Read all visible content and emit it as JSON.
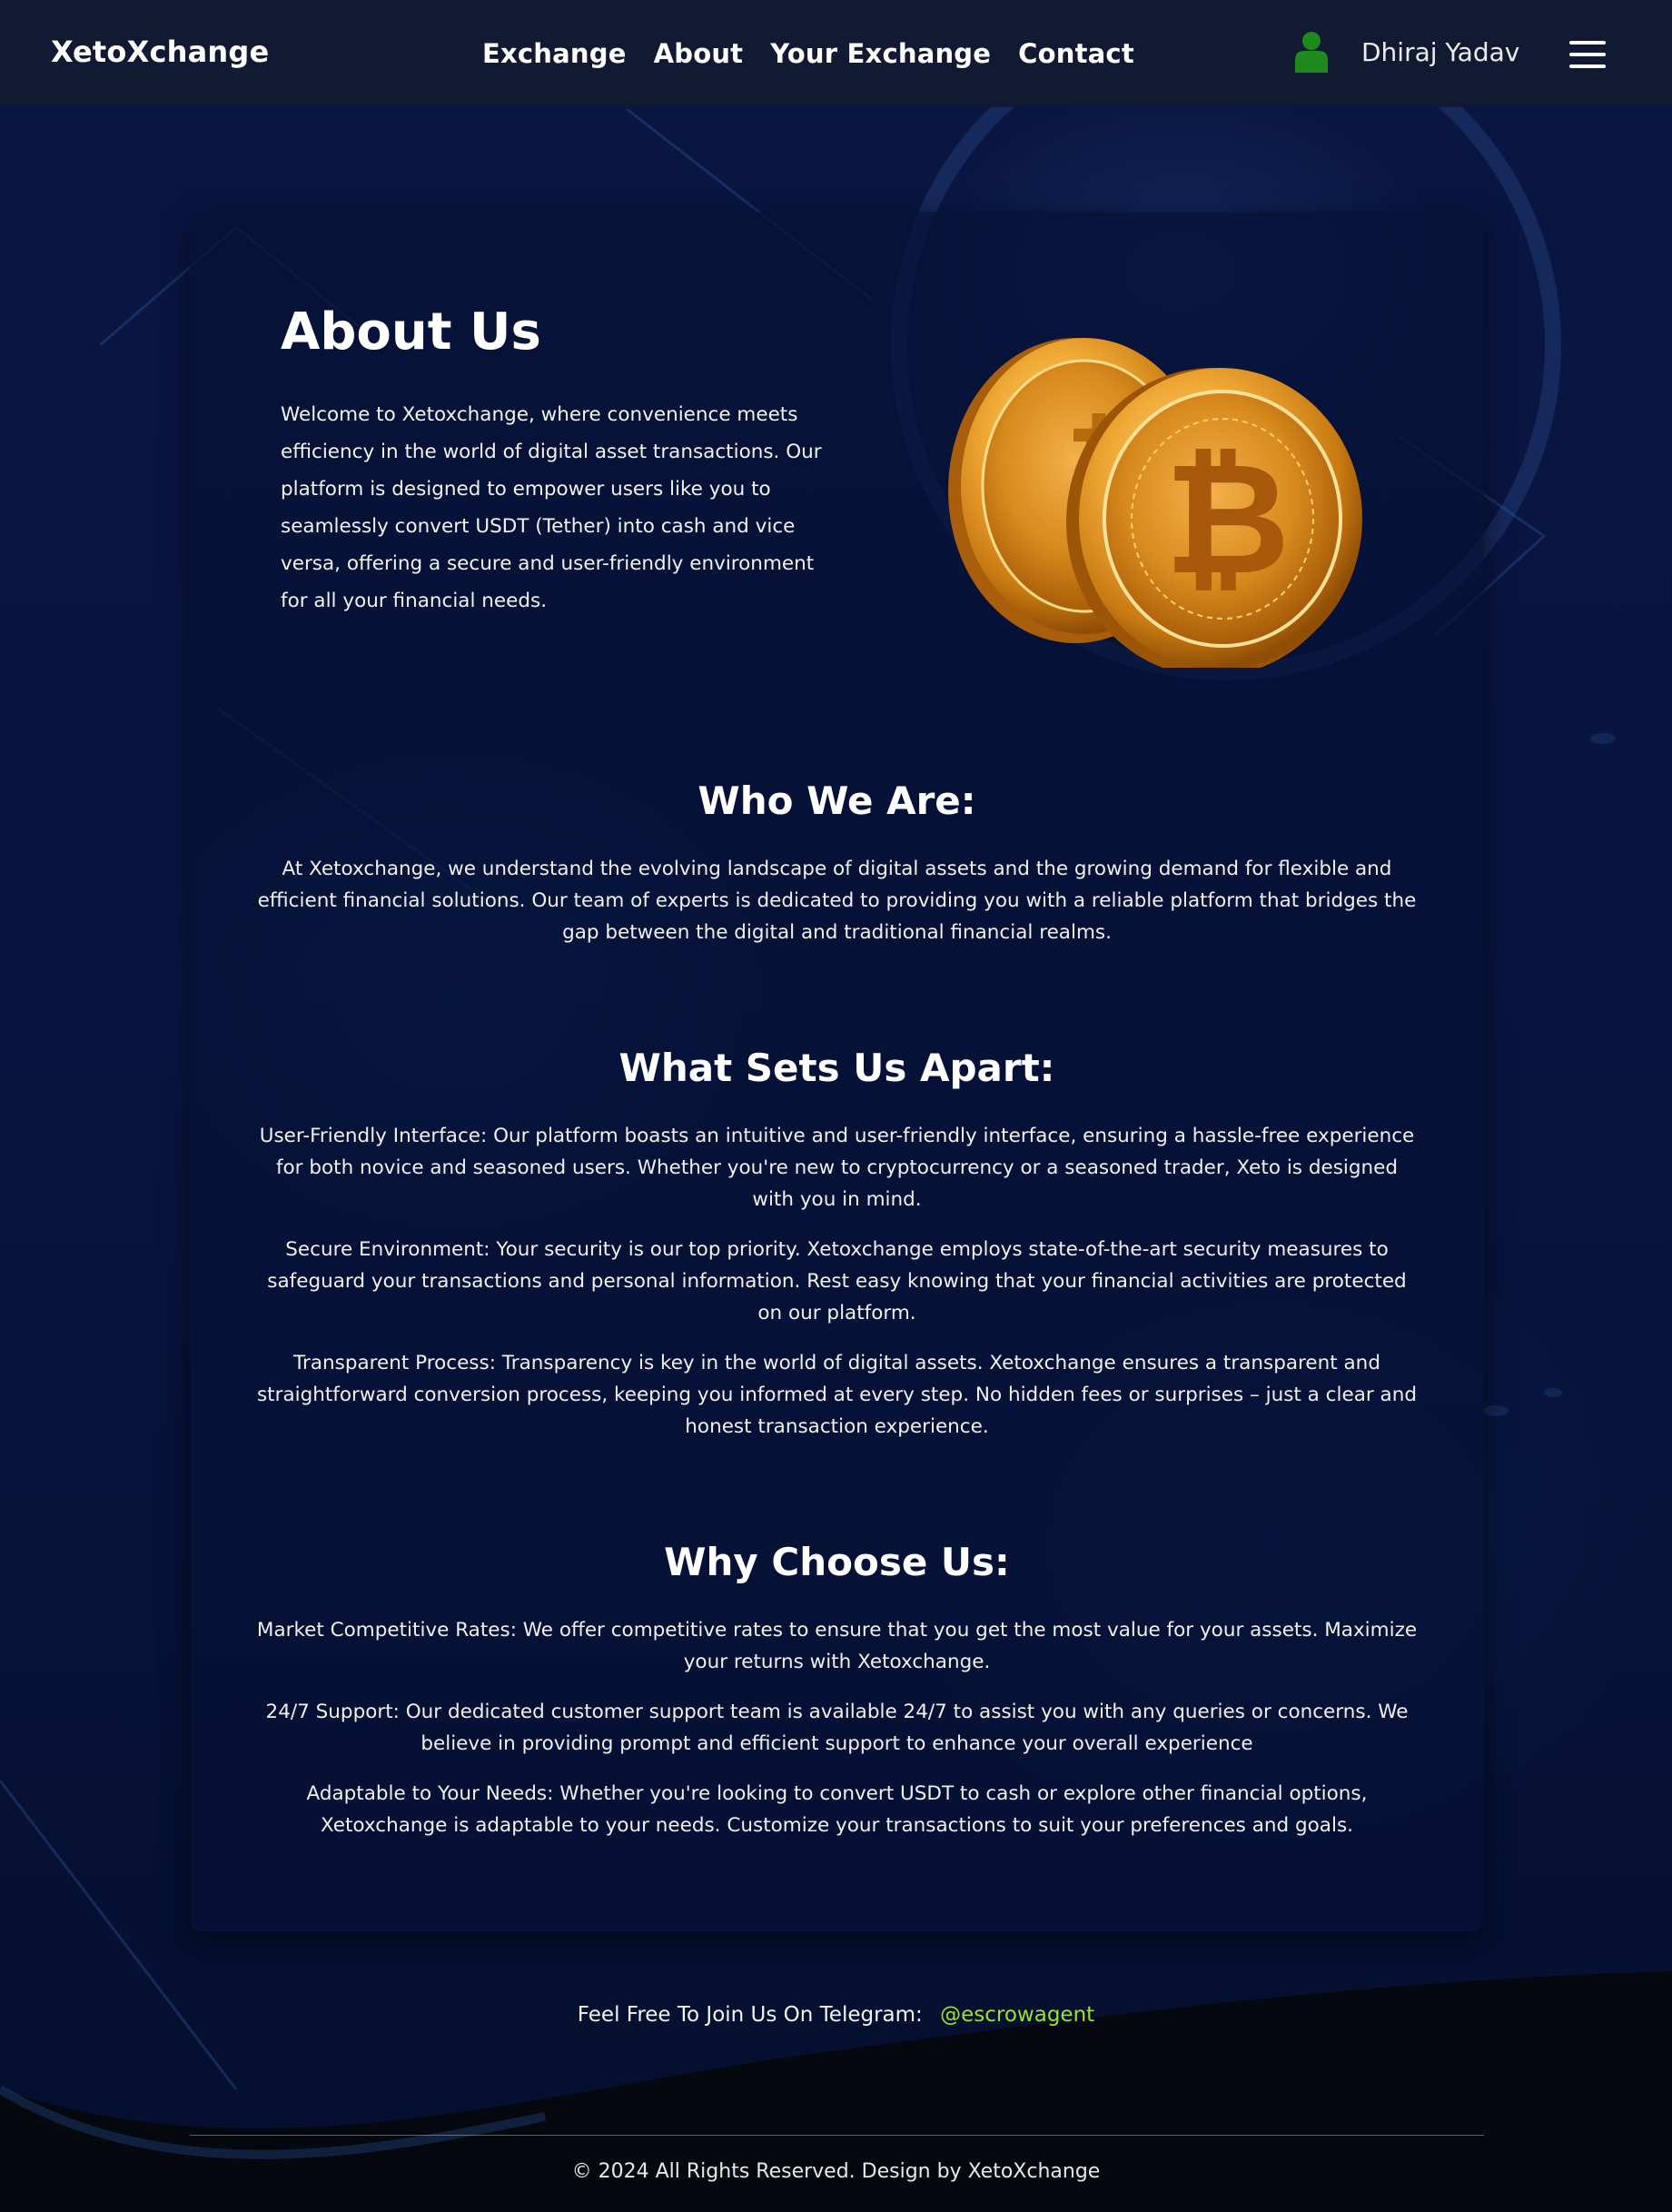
{
  "nav": {
    "brand": "XetoXchange",
    "links": [
      "Exchange",
      "About",
      "Your Exchange",
      "Contact"
    ],
    "user_name": "Dhiraj Yadav",
    "user_icon": "user-icon",
    "menu_icon": "hamburger-icon"
  },
  "about": {
    "title": "About Us",
    "text": "Welcome to Xetoxchange, where convenience meets efficiency in the world of digital asset transactions. Our platform is designed to empower users like you to seamlessly convert USDT (Tether) into cash and vice versa, offering a secure and user-friendly environment for all your financial needs.",
    "image": "bitcoin-coins"
  },
  "who": {
    "title": "Who We Are:",
    "text": "At Xetoxchange, we understand the evolving landscape of digital assets and the growing demand for flexible and efficient financial solutions. Our team of experts is dedicated to providing you with a reliable platform that bridges the gap between the digital and traditional financial realms."
  },
  "apart": {
    "title": "What Sets Us Apart:",
    "items": [
      "User-Friendly Interface: Our platform boasts an intuitive and user-friendly interface, ensuring a hassle-free experience for both novice and seasoned users. Whether you're new to cryptocurrency or a seasoned trader, Xeto is designed with you in mind.",
      "Secure Environment: Your security is our top priority. Xetoxchange employs state-of-the-art security measures to safeguard your transactions and personal information. Rest easy knowing that your financial activities are protected on our platform.",
      "Transparent Process: Transparency is key in the world of digital assets. Xetoxchange ensures a transparent and straightforward conversion process, keeping you informed at every step. No hidden fees or surprises – just a clear and honest transaction experience."
    ]
  },
  "why": {
    "title": "Why Choose Us:",
    "items": [
      "Market Competitive Rates: We offer competitive rates to ensure that you get the most value for your assets. Maximize your returns with Xetoxchange.",
      "24/7 Support: Our dedicated customer support team is available 24/7 to assist you with any queries or concerns. We believe in providing prompt and efficient support to enhance your overall experience",
      "Adaptable to Your Needs: Whether you're looking to convert USDT to cash or explore other financial options, Xetoxchange is adaptable to your needs. Customize your transactions to suit your preferences and goals."
    ]
  },
  "footer": {
    "telegram_label": "Feel Free To Join Us On Telegram:",
    "telegram_handle": "@escrowagent",
    "copyright": "© 2024 All Rights Reserved. Design by XetoXchange"
  },
  "colors": {
    "nav_bg": "#121933",
    "page_bg": "#071235",
    "link_accent": "#9be22e",
    "user_icon": "#1e8a1e"
  }
}
